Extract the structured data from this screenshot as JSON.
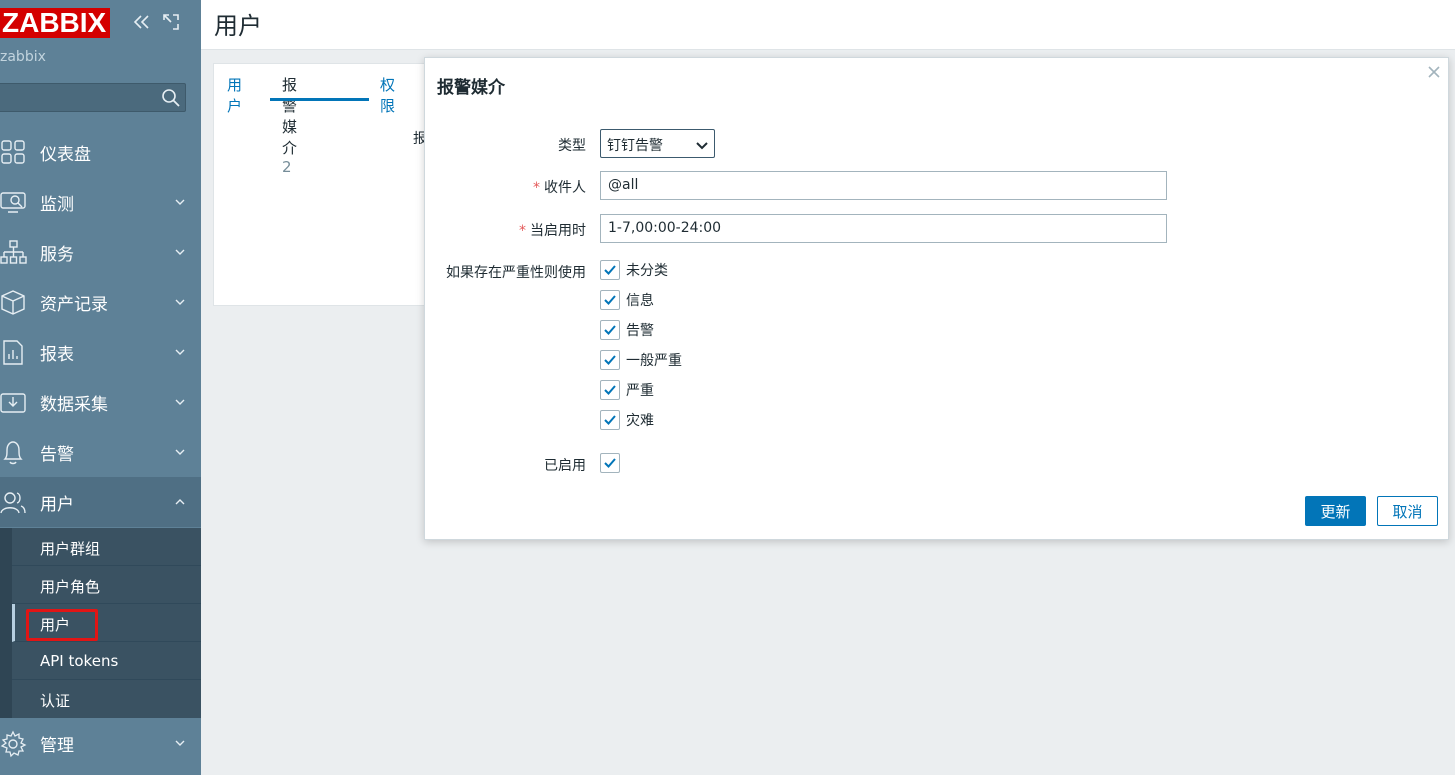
{
  "sidebar": {
    "logo": "ZABBIX",
    "server_name": "zabbix",
    "search_placeholder": "",
    "items": [
      {
        "label": "仪表盘",
        "icon": "dashboard-icon"
      },
      {
        "label": "监测",
        "icon": "monitoring-icon"
      },
      {
        "label": "服务",
        "icon": "services-icon"
      },
      {
        "label": "资产记录",
        "icon": "inventory-icon"
      },
      {
        "label": "报表",
        "icon": "reports-icon"
      },
      {
        "label": "数据采集",
        "icon": "data-collection-icon"
      },
      {
        "label": "告警",
        "icon": "bell-icon"
      },
      {
        "label": "用户",
        "icon": "users-icon"
      },
      {
        "label": "管理",
        "icon": "gear-icon"
      }
    ],
    "submenu": [
      {
        "label": "用户群组"
      },
      {
        "label": "用户角色"
      },
      {
        "label": "用户"
      },
      {
        "label": "API tokens"
      },
      {
        "label": "认证"
      }
    ]
  },
  "header": {
    "title": "用户"
  },
  "form": {
    "tabs": [
      {
        "label": "用户"
      },
      {
        "label": "报警媒介",
        "count": "2"
      },
      {
        "label": "权限"
      }
    ],
    "bg_label": "报"
  },
  "modal": {
    "title": "报警媒介",
    "type_label": "类型",
    "type_value": "钉钉告警",
    "sendto_label": "收件人",
    "sendto_value": "@all",
    "period_label": "当启用时",
    "period_value": "1-7,00:00-24:00",
    "severity_label": "如果存在严重性则使用",
    "severities": [
      {
        "label": "未分类",
        "checked": true
      },
      {
        "label": "信息",
        "checked": true
      },
      {
        "label": "告警",
        "checked": true
      },
      {
        "label": "一般严重",
        "checked": true
      },
      {
        "label": "严重",
        "checked": true
      },
      {
        "label": "灾难",
        "checked": true
      }
    ],
    "enabled_label": "已启用",
    "enabled_checked": true,
    "update_button": "更新",
    "cancel_button": "取消",
    "required_mark": "*"
  },
  "colors": {
    "sidebar_bg": "#5e8197",
    "logo_bg": "#d40000",
    "primary": "#0275b8",
    "required": "#e45959"
  }
}
